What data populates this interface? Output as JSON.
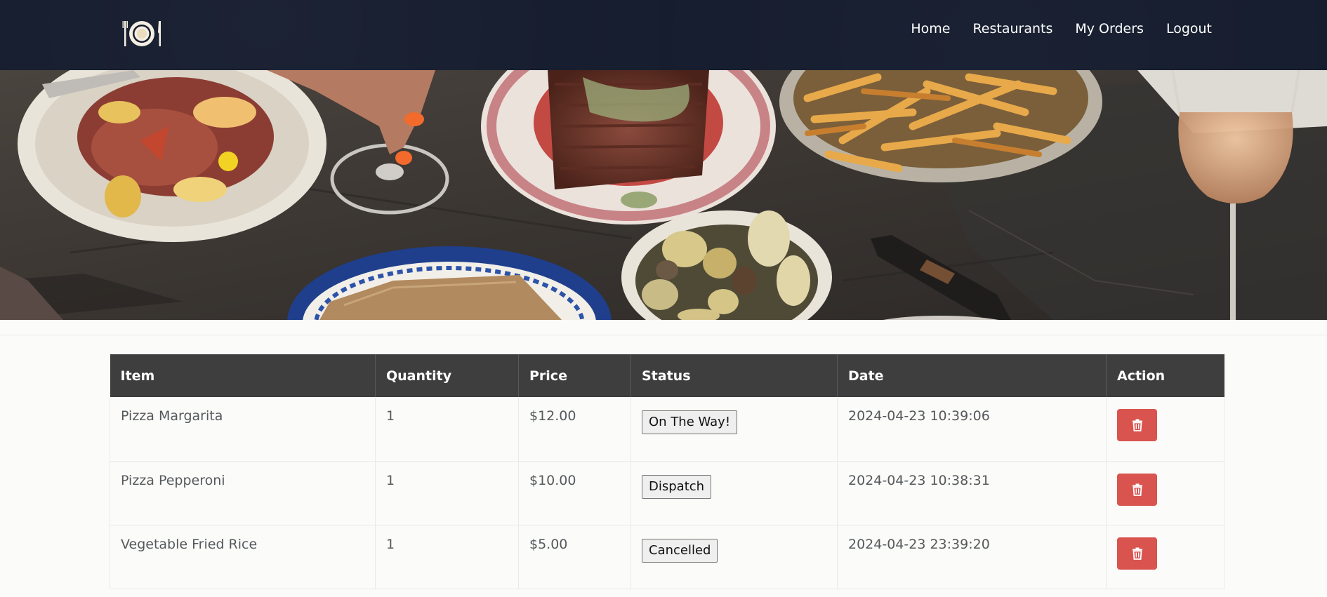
{
  "nav": {
    "items": [
      "Home",
      "Restaurants",
      "My Orders",
      "Logout"
    ]
  },
  "logo": {
    "icon": "plate-with-fork-and-knife-icon"
  },
  "orders": {
    "columns": [
      "Item",
      "Quantity",
      "Price",
      "Status",
      "Date",
      "Action"
    ],
    "rows": [
      {
        "item": "Pizza Margarita",
        "quantity": "1",
        "price": "$12.00",
        "status": "On The Way!",
        "date": "2024-04-23 10:39:06"
      },
      {
        "item": "Pizza Pepperoni",
        "quantity": "1",
        "price": "$10.00",
        "status": "Dispatch",
        "date": "2024-04-23 10:38:31"
      },
      {
        "item": "Vegetable Fried Rice",
        "quantity": "1",
        "price": "$5.00",
        "status": "Cancelled",
        "date": "2024-04-23 23:39:20"
      }
    ],
    "delete_icon": "trash-icon"
  },
  "colors": {
    "header_bg": "#151c2e",
    "table_header_bg": "#3e3e3e",
    "danger": "#d9534f"
  }
}
